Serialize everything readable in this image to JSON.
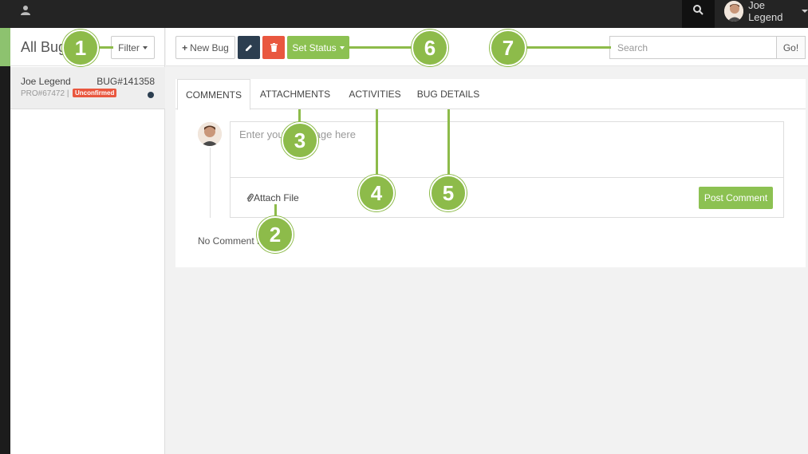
{
  "topbar": {
    "user_menu_label": "Joe Legend"
  },
  "bug_list": {
    "title": "All Bugs",
    "filter_label": "Filter",
    "items": [
      {
        "reporter": "Joe Legend",
        "bug_id": "BUG#141358",
        "project_id": "PRO#67472",
        "status_badge": "Unconfirmed"
      }
    ]
  },
  "toolbar": {
    "new_bug_label": "New Bug",
    "set_status_label": "Set Status",
    "search_placeholder": "Search",
    "go_label": "Go!"
  },
  "tabs": [
    "COMMENTS",
    "ATTACHMENTS",
    "ACTIVITIES",
    "BUG DETAILS"
  ],
  "comments": {
    "input_placeholder": "Enter your message here",
    "attach_label": "Attach File",
    "post_label": "Post Comment",
    "empty_text": "No Comment Found"
  },
  "callouts": [
    "1",
    "2",
    "3",
    "4",
    "5",
    "6",
    "7"
  ],
  "colors": {
    "accent_green": "#8cc152",
    "danger_red": "#e9573f",
    "dark_navy": "#2c3e50",
    "topbar": "#242424"
  }
}
